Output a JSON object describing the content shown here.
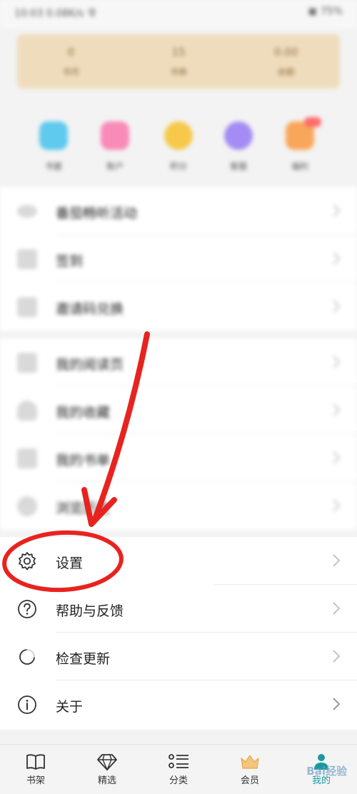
{
  "status_bar": {
    "left": "10:03 0.08K/s 令",
    "right": "▣ 75%"
  },
  "stats": [
    {
      "value": "0",
      "label": "书币"
    },
    {
      "value": "15",
      "label": "书券"
    },
    {
      "value": "0.00",
      "label": "余额"
    }
  ],
  "quick_actions": [
    {
      "label": "书屋",
      "color": "#5fc9ee"
    },
    {
      "label": "账户",
      "color": "#f98bb8"
    },
    {
      "label": "积分",
      "color": "#f6c94a"
    },
    {
      "label": "客服",
      "color": "#a48cf4"
    },
    {
      "label": "福利",
      "color": "#f8a75a"
    }
  ],
  "menu_top": [
    {
      "label": "番茄畅听活动"
    },
    {
      "label": "签到"
    },
    {
      "label": "邀请码兑换"
    }
  ],
  "menu_mid": [
    {
      "label": "我的阅读页"
    },
    {
      "label": "我的收藏"
    },
    {
      "label": "我的书单"
    },
    {
      "label": "浏览历史"
    }
  ],
  "menu_bottom": [
    {
      "label": "设置"
    },
    {
      "label": "帮助与反馈"
    },
    {
      "label": "检查更新"
    },
    {
      "label": "关于"
    }
  ],
  "nav": [
    {
      "label": "书架"
    },
    {
      "label": "精选"
    },
    {
      "label": "分类"
    },
    {
      "label": "会员"
    },
    {
      "label": "我的"
    }
  ],
  "watermark": "Bai经验",
  "colors": {
    "annotation_red": "#e8231f",
    "accent": "#1a9aa0",
    "card": "#efdcbc"
  }
}
